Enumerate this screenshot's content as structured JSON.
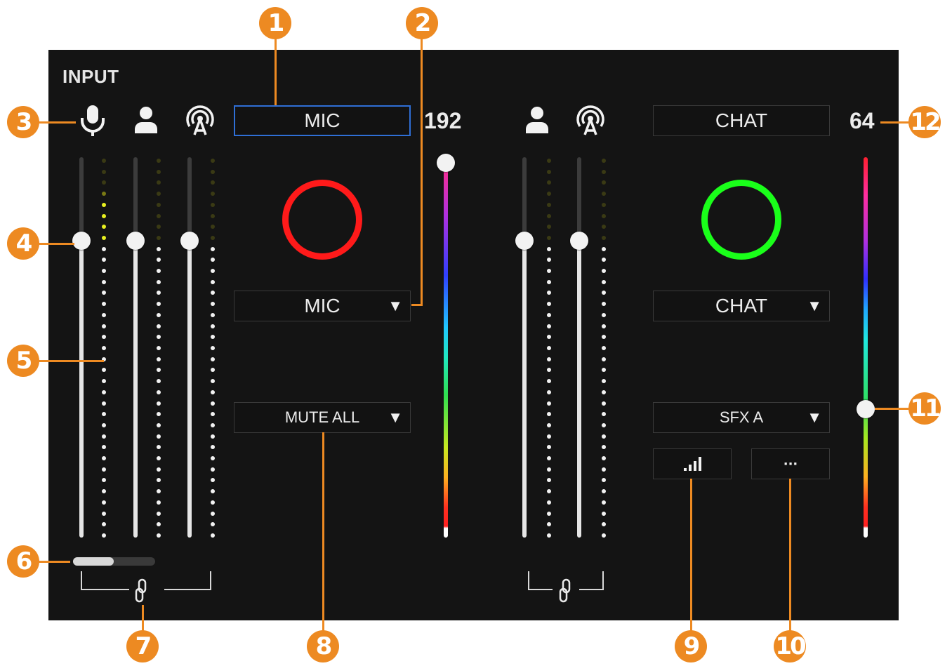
{
  "panel": {
    "title": "INPUT"
  },
  "left_channel": {
    "source_label": "MIC",
    "source_dropdown": "MIC",
    "mute_dropdown": "MUTE ALL",
    "volume_readout": "192",
    "volume_fraction": 1.0
  },
  "right_channel": {
    "source_label": "CHAT",
    "source_dropdown": "CHAT",
    "effect_dropdown": "SFX A",
    "volume_readout": "64",
    "volume_fraction": 0.35,
    "more_button_label": "···"
  },
  "faders": {
    "mic_level": 0.78,
    "monitor_level": 0.78,
    "stream_level": 0.78
  },
  "ring_colors": {
    "left": "#ff1a1a",
    "right": "#1aff1a"
  },
  "accent_color": "#ed8a22",
  "icons": [
    "microphone-icon",
    "person-icon",
    "broadcast-icon",
    "link-icon",
    "signal-bars-icon",
    "dropdown-caret-icon"
  ],
  "callouts": [
    "1",
    "2",
    "3",
    "4",
    "5",
    "6",
    "7",
    "8",
    "9",
    "10",
    "11",
    "12"
  ]
}
